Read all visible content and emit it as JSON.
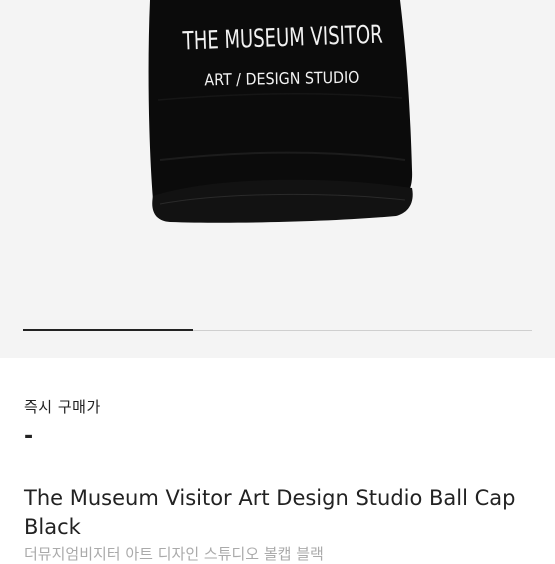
{
  "product": {
    "image": {
      "alt": "cap-product-photo",
      "cap_text_line1": "THE MUSEUM VISITOR",
      "cap_text_line2": "ART / DESIGN STUDIO",
      "colors": {
        "cap": "#0b0b0b",
        "stitch": "#f2f2f2",
        "background": "#f4f4f4"
      }
    },
    "gallery": {
      "current_slide": 1,
      "total_slides": 3
    },
    "price_label": "즉시 구매가",
    "price_value": "-",
    "title": "The Museum Visitor Art Design Studio Ball Cap Black",
    "subtitle": "더뮤지엄비지터 아트 디자인 스튜디오 볼캡 블랙"
  }
}
